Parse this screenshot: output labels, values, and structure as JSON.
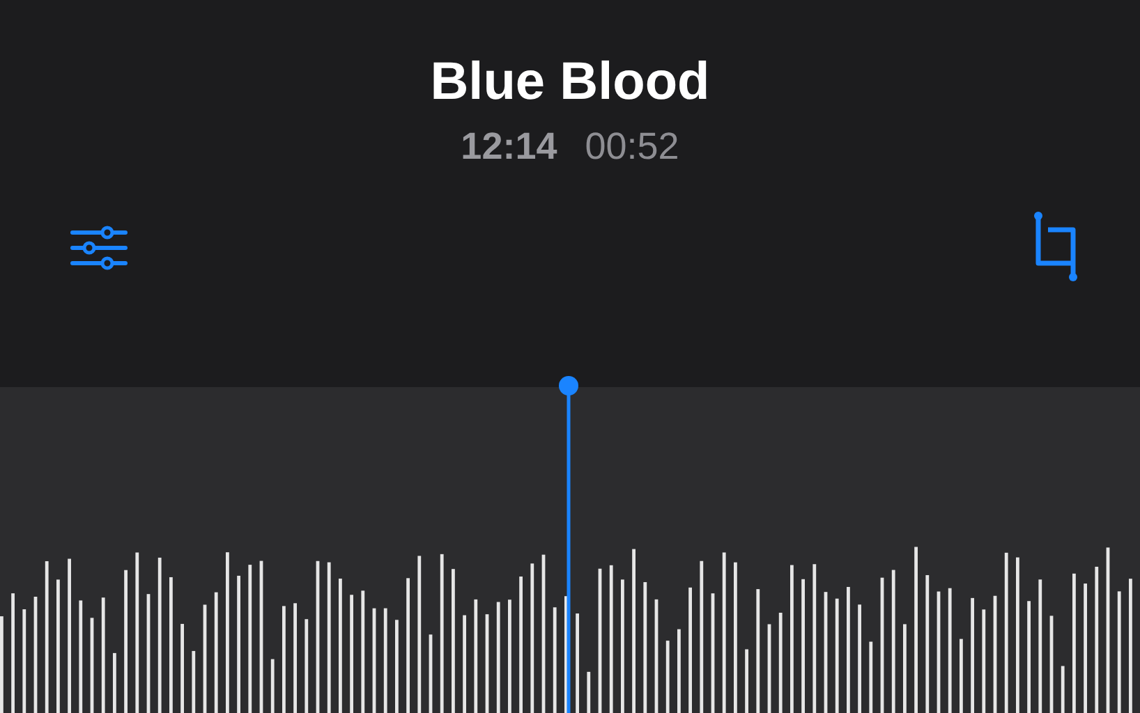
{
  "recording": {
    "title": "Blue Blood",
    "duration": "12:14",
    "position": "00:52"
  },
  "toolbar": [
    {
      "kind": "options"
    },
    {
      "kind": "trim"
    }
  ]
}
